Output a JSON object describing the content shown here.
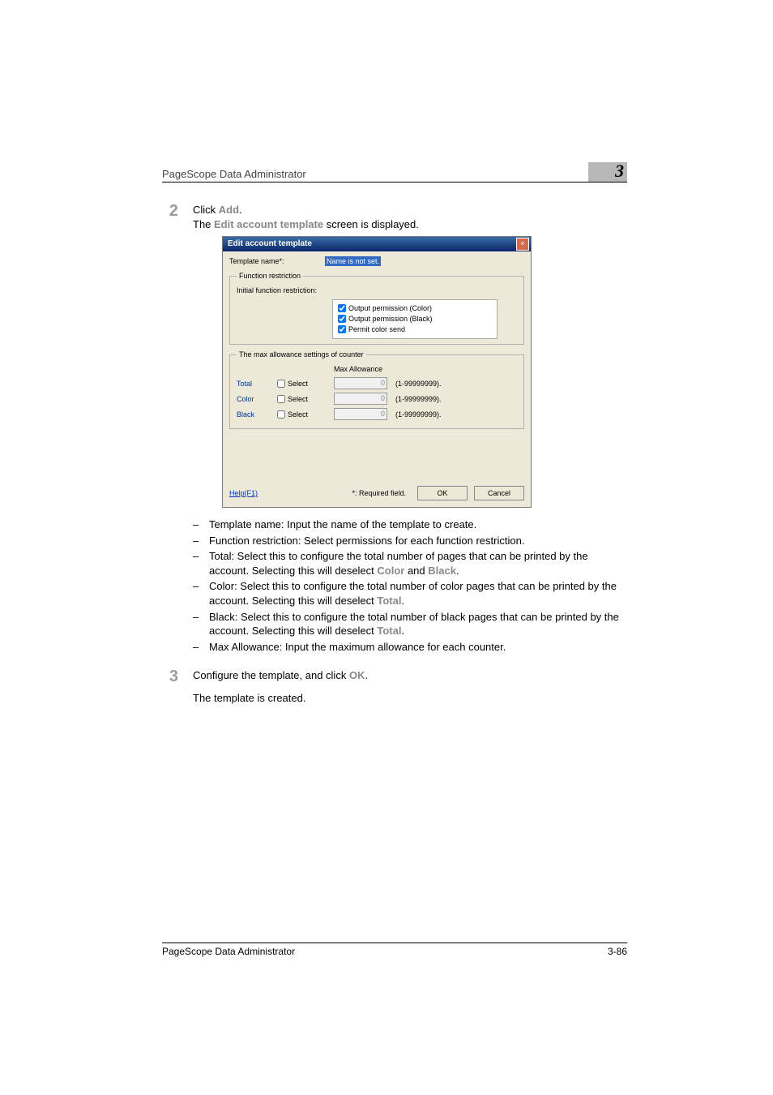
{
  "runhead": {
    "title": "PageScope Data Administrator",
    "chapter": "3"
  },
  "steps": {
    "s2": {
      "num": "2",
      "line1_pre": "Click ",
      "line1_bold": "Add",
      "line1_post": ".",
      "line2_pre": "The ",
      "line2_bold": "Edit account template",
      "line2_post": " screen is displayed."
    },
    "s3": {
      "num": "3",
      "line1_pre": "Configure the template, and click ",
      "line1_bold": "OK",
      "line1_post": ".",
      "line2": "The template is created."
    }
  },
  "dialog": {
    "title": "Edit account template",
    "close": "×",
    "tmpl_label": "Template name*:",
    "tmpl_value": "Name is not set.",
    "fr_legend": "Function restriction",
    "ifr_label": "Initial function restriction:",
    "perm1": "Output permission (Color)",
    "perm2": "Output permission (Black)",
    "perm3": "Permit color send",
    "ma_legend": "The max allowance settings of counter",
    "ma_header": "Max Allowance",
    "rows": [
      {
        "label": "Total",
        "select": "Select",
        "value": "0",
        "range": "(1-99999999)."
      },
      {
        "label": "Color",
        "select": "Select",
        "value": "0",
        "range": "(1-99999999)."
      },
      {
        "label": "Black",
        "select": "Select",
        "value": "0",
        "range": "(1-99999999)."
      }
    ],
    "help": "Help(F1)",
    "req": "*: Required field.",
    "ok": "OK",
    "cancel": "Cancel"
  },
  "bullets": [
    {
      "text": "Template name: Input the name of the template to create."
    },
    {
      "text": "Function restriction: Select permissions for each function restriction."
    },
    {
      "text_pre": "Total: Select this to configure the total number of pages that can be printed by the account. Selecting this will deselect ",
      "bold1": "Color",
      "mid": " and ",
      "bold2": "Black",
      "post": "."
    },
    {
      "text_pre": "Color: Select this to configure the total number of color pages that can be printed by the account. Selecting this will deselect ",
      "bold1": "Total",
      "post": "."
    },
    {
      "text_pre": "Black: Select this to configure the total number of black pages that can be printed by the account. Selecting this will deselect ",
      "bold1": "Total",
      "post": "."
    },
    {
      "text": "Max Allowance: Input the maximum allowance for each counter."
    }
  ],
  "footer": {
    "title": "PageScope Data Administrator",
    "page": "3-86"
  }
}
